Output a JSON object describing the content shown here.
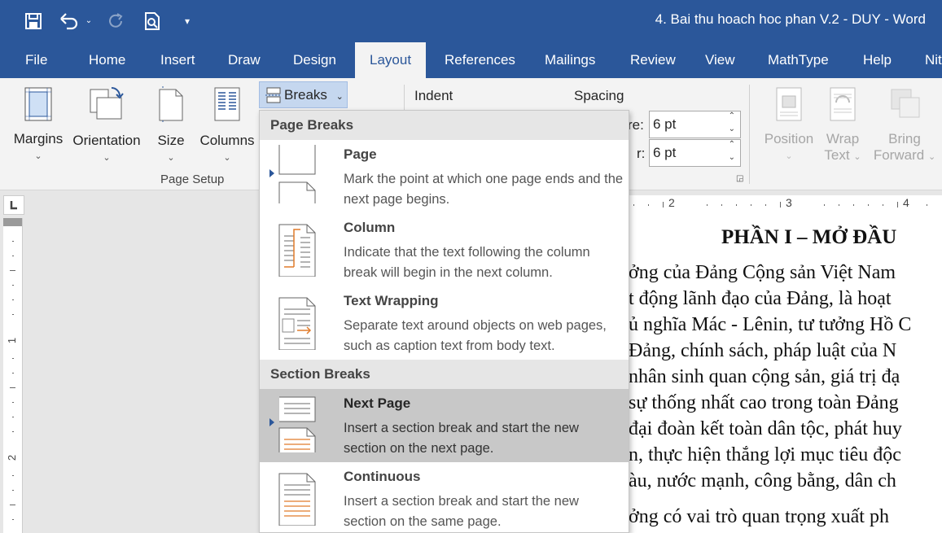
{
  "app": {
    "title": "4. Bai thu hoach hoc phan V.2 - DUY  -  Word"
  },
  "qat": {
    "save_icon": "save-icon",
    "undo_icon": "undo-icon",
    "redo_icon": "redo-icon",
    "preview_icon": "print-preview-icon",
    "customize_icon": "customize-qat-icon"
  },
  "tabs": [
    "File",
    "Home",
    "Insert",
    "Draw",
    "Design",
    "Layout",
    "References",
    "Mailings",
    "Review",
    "View",
    "MathType",
    "Help",
    "Nit"
  ],
  "active_tab": "Layout",
  "ribbon": {
    "margins": "Margins",
    "orientation": "Orientation",
    "size": "Size",
    "columns": "Columns",
    "breaks": "Breaks",
    "page_setup_group": "Page Setup",
    "indent": "Indent",
    "spacing": "Spacing",
    "before_label": "re:",
    "after_label": "r:",
    "spacing_before": "6 pt",
    "spacing_after": "6 pt",
    "position": "Position",
    "wrap_text_1": "Wrap",
    "wrap_text_2": "Text",
    "bring_forward_1": "Bring",
    "bring_forward_2": "Forward"
  },
  "ruler": {
    "h_ticks": [
      "2",
      "3",
      "4"
    ],
    "v_ticks": [
      "1",
      "2"
    ]
  },
  "breaks_menu": {
    "page_breaks_header": "Page Breaks",
    "section_breaks_header": "Section Breaks",
    "items": [
      {
        "title": "Page",
        "desc": "Mark the point at which one page ends and the next page begins."
      },
      {
        "title": "Column",
        "desc": "Indicate that the text following the column break will begin in the next column."
      },
      {
        "title": "Text Wrapping",
        "desc": "Separate text around objects on web pages, such as caption text from body text."
      },
      {
        "title": "Next Page",
        "desc": "Insert a section break and start the new section on the next page."
      },
      {
        "title": "Continuous",
        "desc": "Insert a section break and start the new section on the same page."
      }
    ]
  },
  "document": {
    "heading": "PHẦN I – MỞ ĐẦU",
    "lines": [
      "ởng của Đảng Cộng sản Việt Nam",
      "t động lãnh đạo của Đảng, là hoạt",
      "ủ nghĩa Mác - Lênin, tư tưởng Hồ C",
      "Đảng, chính sách, pháp luật của N",
      "nhân sinh quan cộng sản, giá trị đạ",
      "sự thống nhất cao trong toàn Đảng",
      "đại đoàn kết toàn dân tộc, phát huy",
      "n, thực hiện thắng lợi mục tiêu độc",
      "àu, nước mạnh, công bằng, dân ch",
      "ởng có vai trò quan trọng xuất ph"
    ]
  },
  "colors": {
    "brand": "#2b579a",
    "ribbon_bg": "#f3f3f3",
    "menu_highlight": "#c8c8c8"
  }
}
